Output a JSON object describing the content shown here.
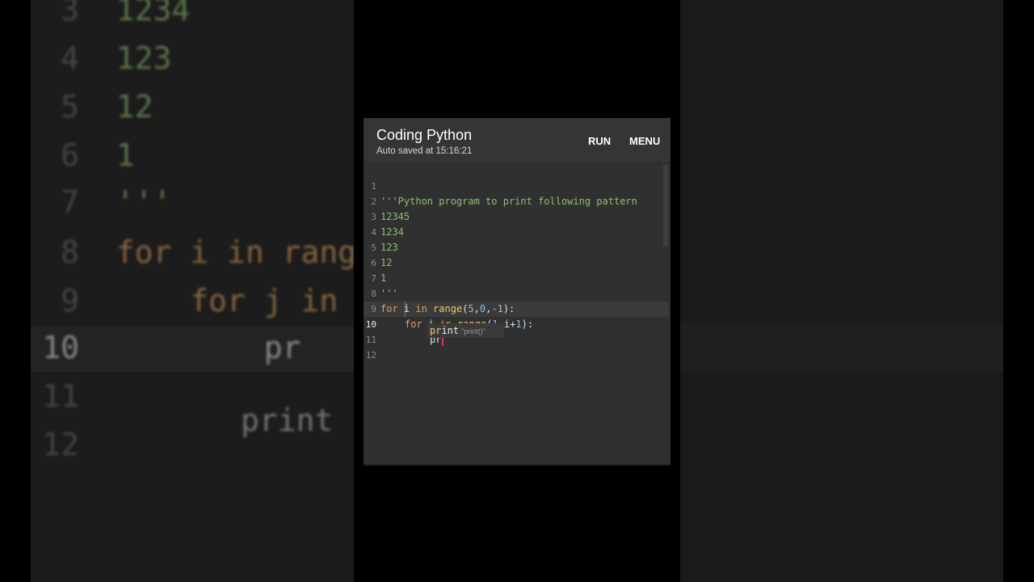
{
  "background_left": {
    "lines": [
      {
        "num": "3",
        "code": "1234"
      },
      {
        "num": "4",
        "code": "123"
      },
      {
        "num": "5",
        "code": "12"
      },
      {
        "num": "6",
        "code": "1"
      },
      {
        "num": "7",
        "code": "'''"
      },
      {
        "num": "8",
        "code": "for i in range"
      },
      {
        "num": "9",
        "code": "    for j in r"
      },
      {
        "num": "10",
        "code": "        pr"
      },
      {
        "num": "11",
        "code": ""
      },
      {
        "num": "12",
        "code": ""
      }
    ],
    "suggestion": "print"
  },
  "toolbar": {
    "title": "Coding Python",
    "subtitle": "Auto saved at 15:16:21",
    "run_label": "RUN",
    "menu_label": "MENU"
  },
  "editor": {
    "line_numbers": [
      "1",
      "2",
      "3",
      "4",
      "5",
      "6",
      "7",
      "8",
      "9",
      "10",
      "11",
      "12"
    ],
    "active_line": "10",
    "lines": {
      "l1": "'''Python program to print following pattern",
      "l2": "12345",
      "l3": "1234",
      "l4": "123",
      "l5": "12",
      "l6": "1",
      "l7": "'''",
      "l8_kw1": "for",
      "l8_var": " i ",
      "l8_kw2": "in",
      "l8_fn": " range",
      "l8_p1": "(",
      "l8_n1": "5",
      "l8_c1": ",",
      "l8_n2": "0",
      "l8_c2": ",",
      "l8_n3": "-1",
      "l8_p2": "):",
      "l9_kw1": "for",
      "l9_var": " j ",
      "l9_kw2": "in",
      "l9_fn": " range",
      "l9_p1": "(",
      "l9_n1": "1",
      "l9_c1": ",",
      "l9_var2": "i",
      "l9_plus": "+",
      "l9_n2": "1",
      "l9_p2": "):",
      "l10": "pr"
    }
  },
  "autocomplete": {
    "match": "pr",
    "rest": "int",
    "description": "\"print()\""
  },
  "colors": {
    "keyword": "#e0a060",
    "function": "#f2c66d",
    "number": "#8fbce0",
    "string": "#8fbf6f",
    "caret": "#e0306a"
  }
}
